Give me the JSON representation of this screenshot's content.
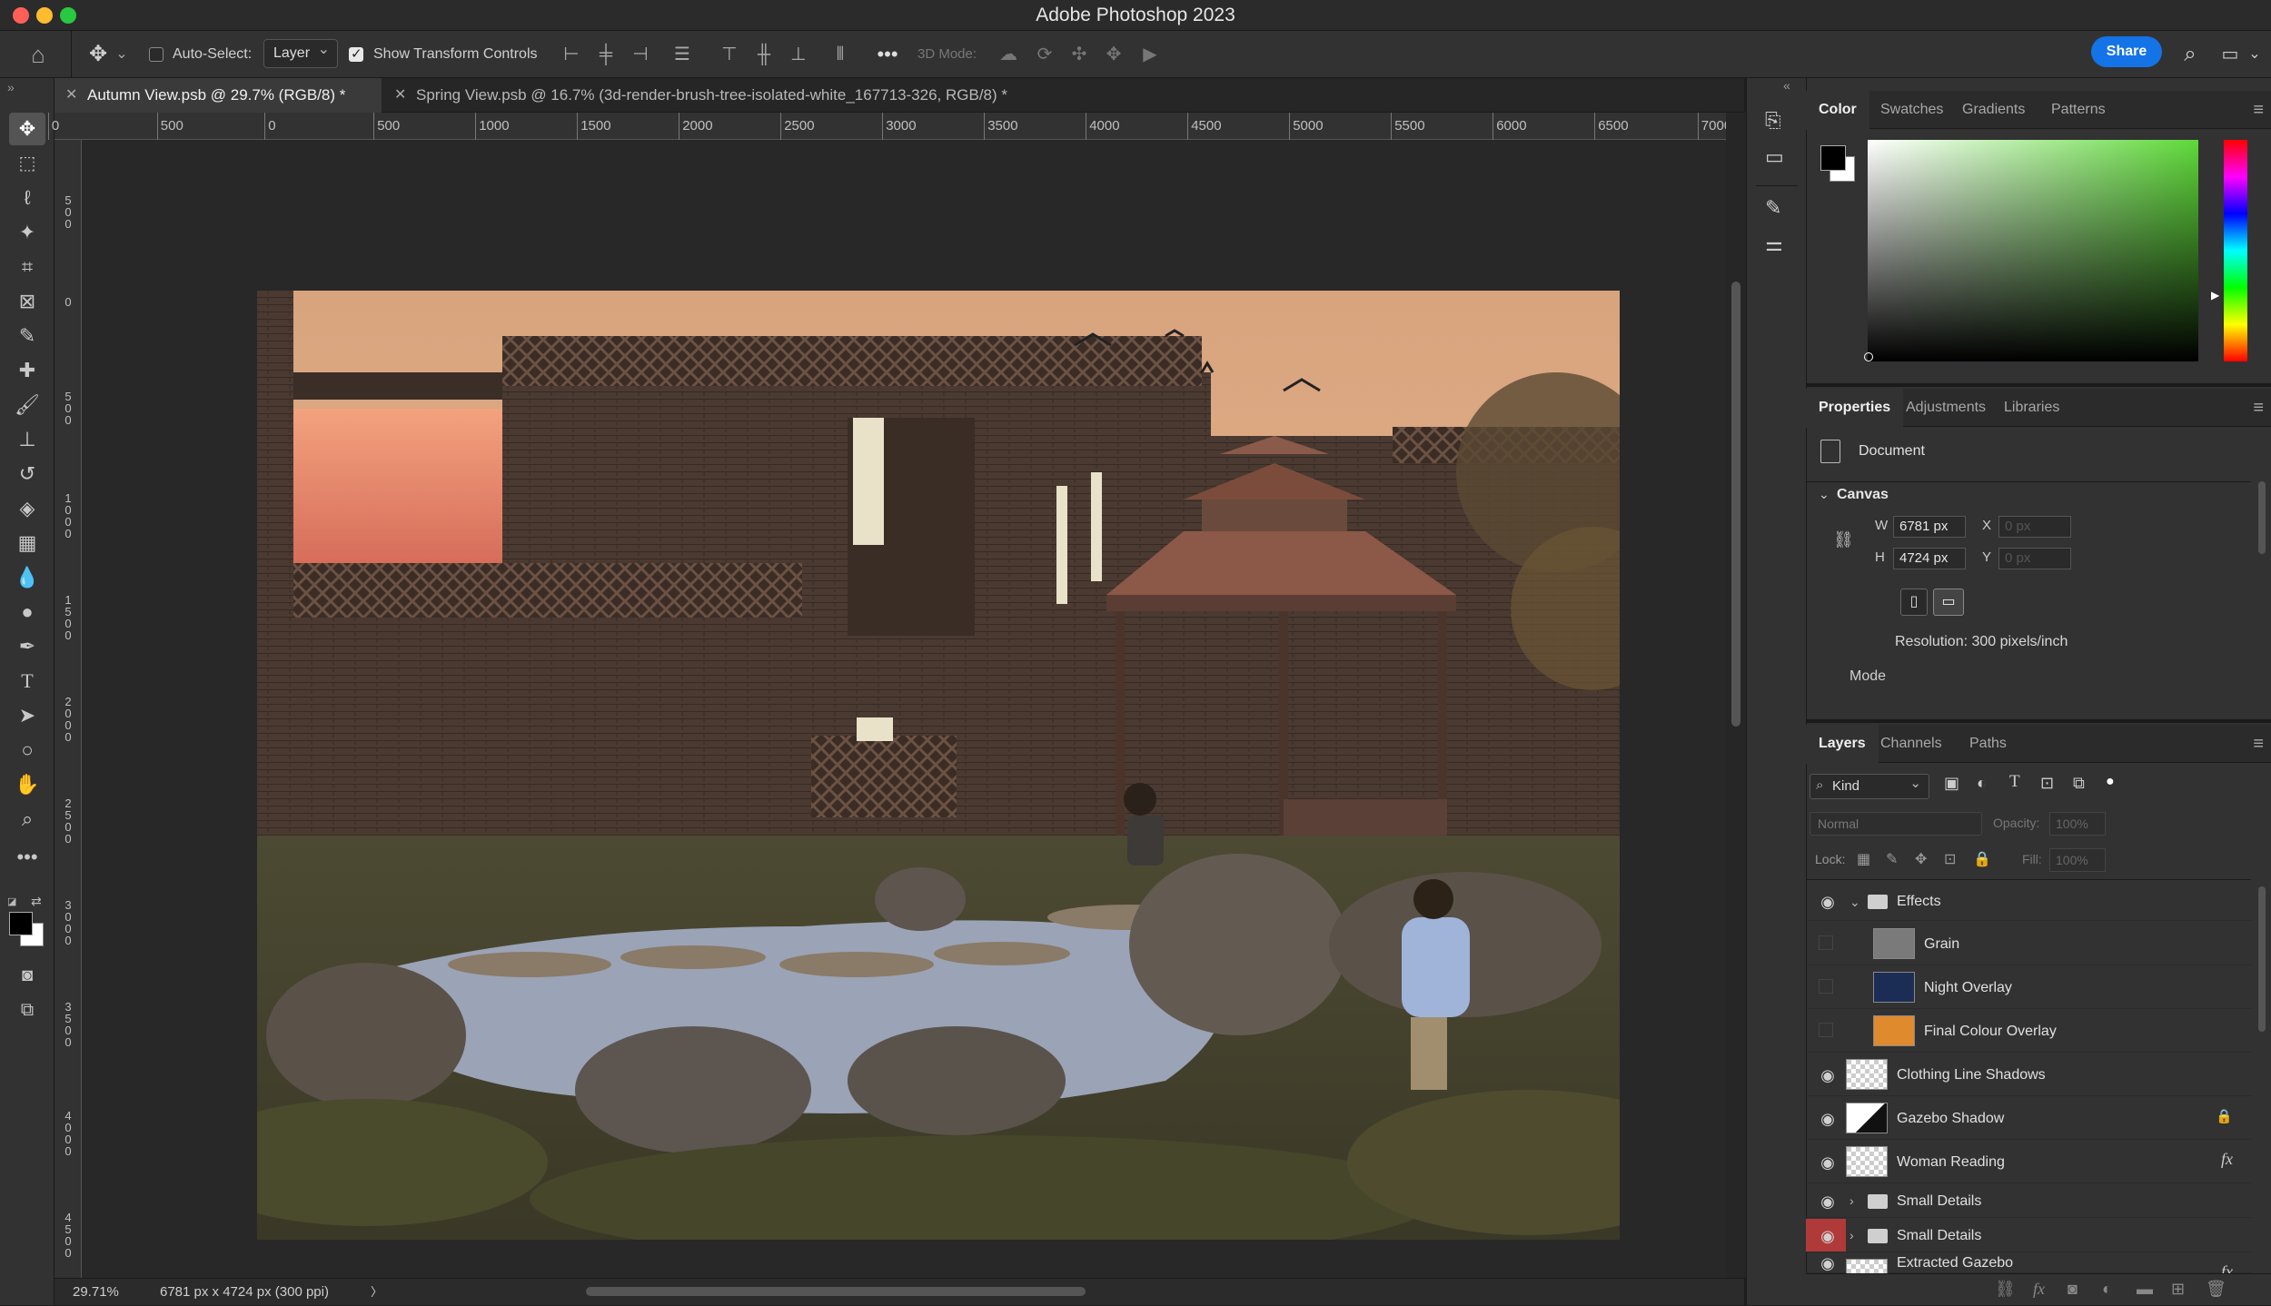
{
  "app": {
    "title": "Adobe Photoshop 2023"
  },
  "options_bar": {
    "auto_select_label": "Auto-Select:",
    "auto_select_checked": false,
    "layer_select": "Layer",
    "show_transform_label": "Show Transform Controls",
    "show_transform_checked": true,
    "mode_3d_label": "3D Mode:",
    "share_label": "Share"
  },
  "tabs": [
    {
      "label": "Autumn View.psb @ 29.7% (RGB/8) *",
      "active": true
    },
    {
      "label": "Spring View.psb @ 16.7% (3d-render-brush-tree-isolated-white_167713-326, RGB/8) *",
      "active": false
    }
  ],
  "ruler": {
    "h_labels": [
      "0",
      "500",
      "0",
      "500",
      "1000",
      "1500",
      "2000",
      "2500",
      "3000",
      "3500",
      "4000",
      "4500",
      "5000",
      "5500",
      "6000",
      "6500",
      "7000"
    ],
    "v_labels": [
      "500",
      "0",
      "500",
      "1000",
      "1500",
      "2000",
      "2500",
      "3000",
      "3500",
      "4000",
      "4500"
    ]
  },
  "status": {
    "zoom": "29.71%",
    "doc_info": "6781 px x 4724 px (300 ppi)",
    "arrow": "〉"
  },
  "color_panel": {
    "tabs": [
      "Color",
      "Swatches",
      "Gradients",
      "Patterns"
    ],
    "foreground": "#000000",
    "background": "#ffffff",
    "hue_color": "#5fd93a"
  },
  "properties_panel": {
    "tabs": [
      "Properties",
      "Adjustments",
      "Libraries"
    ],
    "type_label": "Document",
    "section": "Canvas",
    "w_label": "W",
    "w_value": "6781 px",
    "h_label": "H",
    "h_value": "4724 px",
    "x_label": "X",
    "x_value": "0 px",
    "y_label": "Y",
    "y_value": "0 px",
    "resolution": "Resolution: 300 pixels/inch",
    "mode_label": "Mode"
  },
  "layers_panel": {
    "tabs": [
      "Layers",
      "Channels",
      "Paths"
    ],
    "filter_kind": "Kind",
    "blend_mode": "Normal",
    "opacity_label": "Opacity:",
    "opacity_value": "100%",
    "lock_label": "Lock:",
    "fill_label": "Fill:",
    "fill_value": "100%",
    "layers": [
      {
        "name": "Effects",
        "type": "group",
        "visible": true,
        "expanded": true,
        "indent": 0
      },
      {
        "name": "Grain",
        "type": "layer",
        "visible": false,
        "indent": 1,
        "thumb": "#7a7a7a"
      },
      {
        "name": "Night Overlay",
        "type": "layer",
        "visible": false,
        "indent": 1,
        "thumb": "#1c2d55"
      },
      {
        "name": "Final Colour Overlay",
        "type": "layer",
        "visible": false,
        "indent": 1,
        "thumb": "#e08a2e"
      },
      {
        "name": "Clothing Line Shadows",
        "type": "layer",
        "visible": true,
        "indent": 0,
        "thumb": "checker"
      },
      {
        "name": "Gazebo Shadow",
        "type": "layer",
        "visible": true,
        "indent": 0,
        "thumb": "shadow",
        "locked": true
      },
      {
        "name": "Woman Reading",
        "type": "layer",
        "visible": true,
        "indent": 0,
        "thumb": "checker",
        "fx": "fx"
      },
      {
        "name": "Small Details",
        "type": "group",
        "visible": true,
        "expanded": false,
        "indent": 0
      },
      {
        "name": "Small Details",
        "type": "group",
        "visible": true,
        "expanded": false,
        "indent": 0,
        "highlight_eye": true
      },
      {
        "name": "Extracted Gazebo",
        "type": "layer",
        "visible": true,
        "indent": 0,
        "thumb": "checker",
        "fx": "fx"
      }
    ]
  }
}
